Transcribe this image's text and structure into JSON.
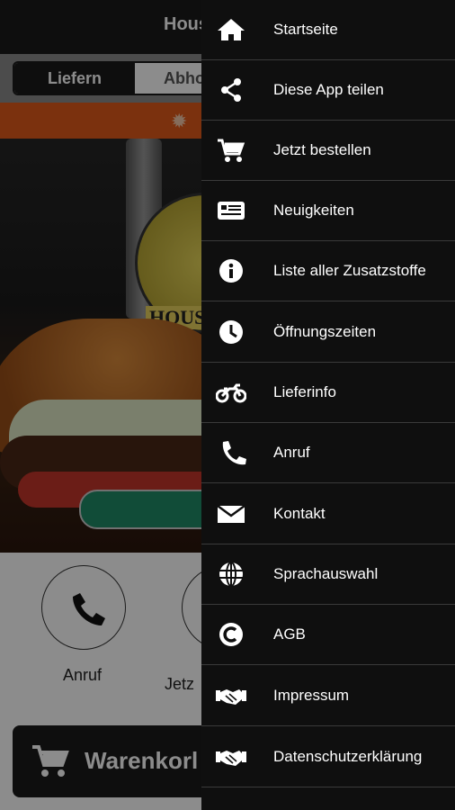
{
  "app": {
    "title": "Hous",
    "segments": {
      "delivery": "Liefern",
      "pickup": "Abho"
    },
    "hero_logo_text": "HOUS",
    "quick_actions": [
      {
        "label": "Anruf"
      },
      {
        "label": "Jetz"
      }
    ],
    "cart_label": "Warenkorl"
  },
  "drawer": {
    "items": [
      {
        "label": "Startseite",
        "icon": "home-icon"
      },
      {
        "label": "Diese App teilen",
        "icon": "share-icon"
      },
      {
        "label": "Jetzt bestellen",
        "icon": "cart-icon"
      },
      {
        "label": "Neuigkeiten",
        "icon": "news-icon"
      },
      {
        "label": "Liste aller Zusatzstoffe",
        "icon": "info-icon"
      },
      {
        "label": "Öffnungszeiten",
        "icon": "clock-icon"
      },
      {
        "label": "Lieferinfo",
        "icon": "motorcycle-icon"
      },
      {
        "label": "Anruf",
        "icon": "phone-icon"
      },
      {
        "label": "Kontakt",
        "icon": "envelope-icon"
      },
      {
        "label": "Sprachauswahl",
        "icon": "globe-icon"
      },
      {
        "label": "AGB",
        "icon": "copyright-icon"
      },
      {
        "label": "Impressum",
        "icon": "handshake-icon"
      },
      {
        "label": "Datenschutzerklärung",
        "icon": "handshake-icon"
      }
    ]
  },
  "colors": {
    "drawer_bg": "#0f0f0f",
    "banner": "#e05a1b",
    "order_button": "#1f8a66"
  }
}
